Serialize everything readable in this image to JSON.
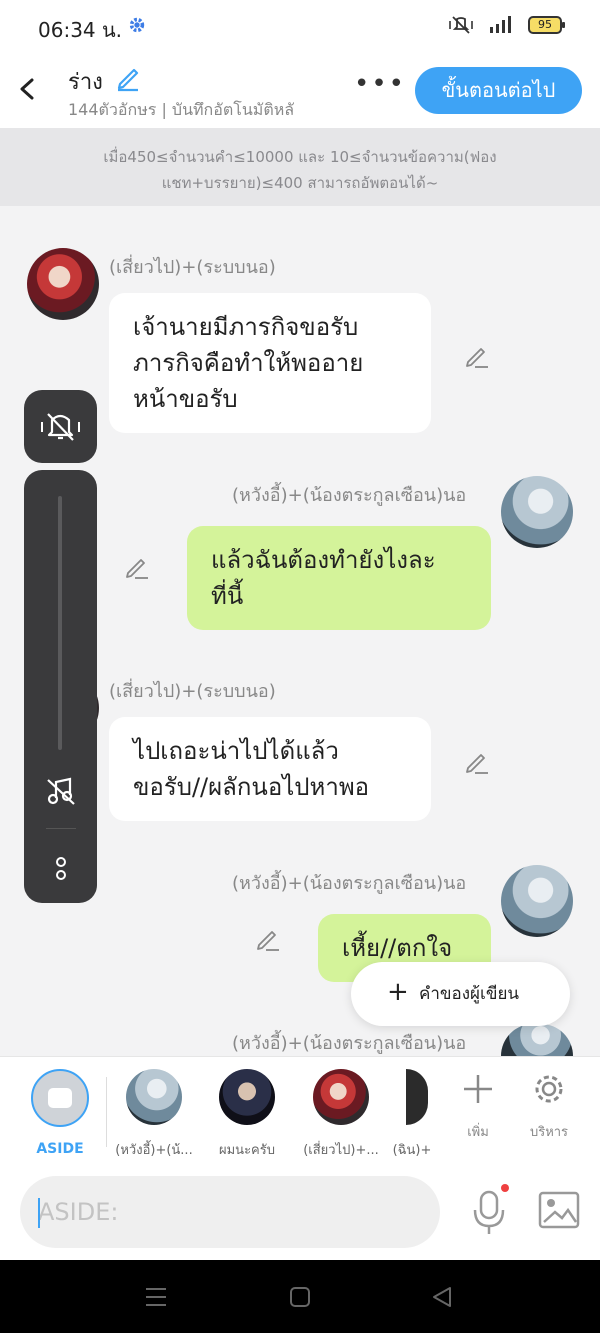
{
  "status_bar": {
    "time": "06:34 น.",
    "battery": "95",
    "icons": [
      "settings-icon",
      "mute-vibrate-icon",
      "signal-icon"
    ]
  },
  "header": {
    "title": "ร่าง",
    "subtitle": "144ตัวอักษร | บันทึกอัตโนมัติหลั",
    "more_label": "•••",
    "next_button": "ขั้นตอนต่อไป"
  },
  "notice": "เมื่อ450≤จำนวนคำ≤10000 และ 10≤จำนวนข้อความ(ฟองแชท+บรรยาย)≤400 สามารถอัพตอนได้~",
  "messages": [
    {
      "side": "left",
      "sender": "(เสี่ยวไป)+(ระบบนอ)",
      "text": "เจ้านายมีภารกิจขอรับ\nภารกิจคือทำให้พออาย\nหน้าขอรับ"
    },
    {
      "side": "right",
      "sender": "(หวังอี้)+(น้องตระกูลเซือน)นอ",
      "text": "แล้วฉันต้องทำยังไงละ\nที่นี้"
    },
    {
      "side": "left",
      "sender": "(เสี่ยวไป)+(ระบบนอ)",
      "text": "ไปเถอะน่าไปได้แล้ว\nขอรับ//ผลักนอไปหาพอ"
    },
    {
      "side": "right",
      "sender": "(หวังอี้)+(น้องตระกูลเซือน)นอ",
      "text": "เหี้ย//ตกใจ"
    },
    {
      "side": "right",
      "sender": "(หวังอี้)+(น้องตระกูลเซือน)นอ",
      "text": ""
    }
  ],
  "author_note": {
    "plus": "+",
    "label": "คำของผู้เขียน"
  },
  "characters": {
    "aside_label": "ASIDE",
    "items": [
      {
        "label": "(หวังอี้)+(น้..."
      },
      {
        "label": "ผมนะครับ"
      },
      {
        "label": "(เสี่ยวไป)+..."
      },
      {
        "label": "(ฉิน)+"
      }
    ],
    "add_label": "เพิ่ม",
    "manage_label": "บริหาร"
  },
  "input": {
    "placeholder": "ASIDE:"
  },
  "colors": {
    "accent": "#3ea3f5",
    "right_bubble": "#d4f39a",
    "left_bubble": "#ffffff"
  }
}
